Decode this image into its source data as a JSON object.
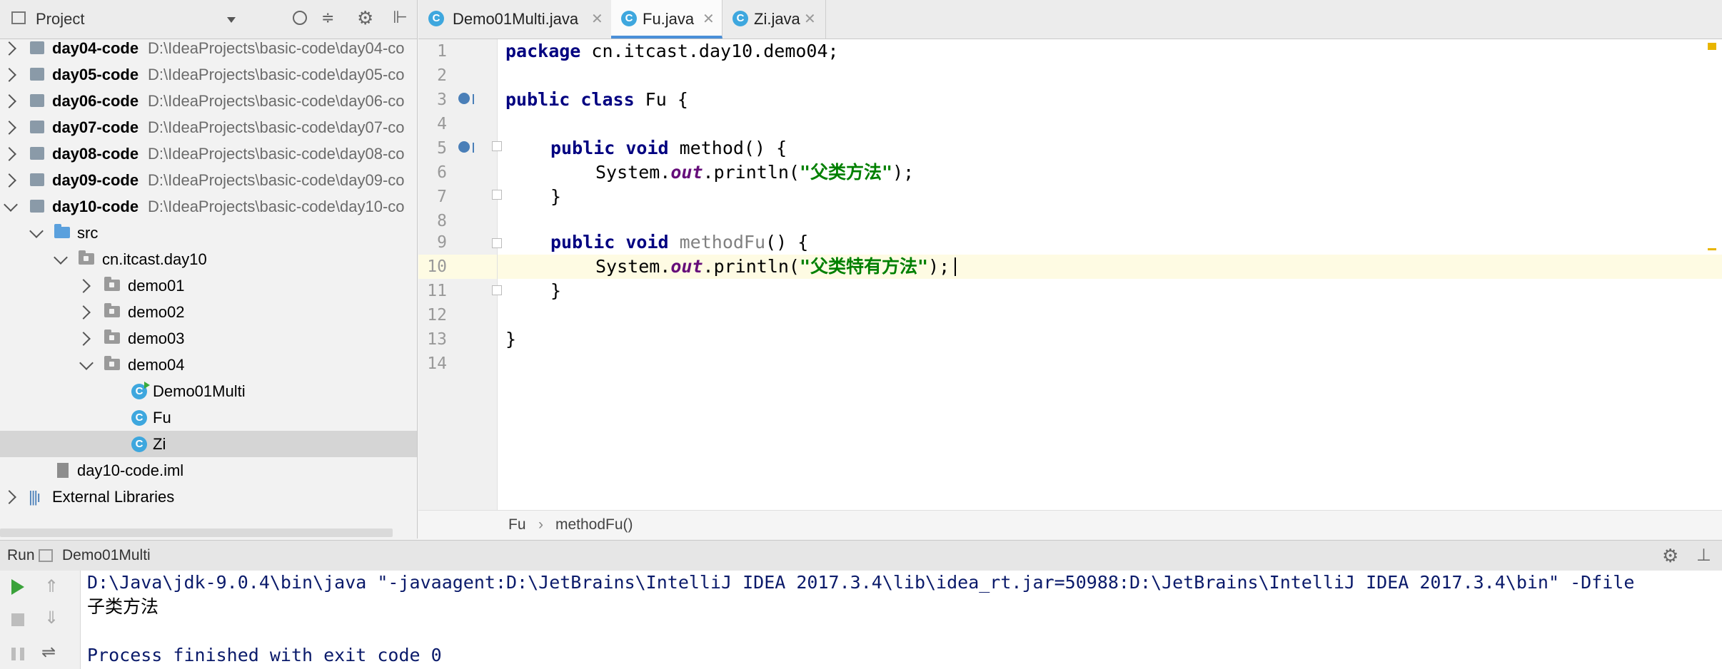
{
  "project": {
    "header_label": "Project",
    "tree": [
      {
        "label": "day04-code",
        "path": "D:\\IdeaProjects\\basic-code\\day04-co"
      },
      {
        "label": "day05-code",
        "path": "D:\\IdeaProjects\\basic-code\\day05-co"
      },
      {
        "label": "day06-code",
        "path": "D:\\IdeaProjects\\basic-code\\day06-co"
      },
      {
        "label": "day07-code",
        "path": "D:\\IdeaProjects\\basic-code\\day07-co"
      },
      {
        "label": "day08-code",
        "path": "D:\\IdeaProjects\\basic-code\\day08-co"
      },
      {
        "label": "day09-code",
        "path": "D:\\IdeaProjects\\basic-code\\day09-co"
      },
      {
        "label": "day10-code",
        "path": "D:\\IdeaProjects\\basic-code\\day10-co"
      }
    ],
    "src": "src",
    "package": "cn.itcast.day10",
    "demos": [
      "demo01",
      "demo02",
      "demo03",
      "demo04"
    ],
    "classes": [
      "Demo01Multi",
      "Fu",
      "Zi"
    ],
    "iml": "day10-code.iml",
    "external": "External Libraries"
  },
  "tabs": [
    {
      "label": "Demo01Multi.java"
    },
    {
      "label": "Fu.java"
    },
    {
      "label": "Zi.java"
    }
  ],
  "editor": {
    "line_numbers": [
      "1",
      "2",
      "3",
      "4",
      "5",
      "6",
      "7",
      "8",
      "9",
      "10",
      "11",
      "12",
      "13",
      "14"
    ],
    "l1_kw": "package",
    "l1_rest": " cn.itcast.day10.demo04;",
    "l3_kw": "public class",
    "l3_rest": " Fu {",
    "l5_kw": "public void",
    "l5_rest": " method() {",
    "l6_a": "System.",
    "l6_field": "out",
    "l6_b": ".println(",
    "l6_str": "\"父类方法\"",
    "l6_c": ");",
    "l7": "}",
    "l9_kw": "public void",
    "l9_name": " methodFu",
    "l9_rest": "() {",
    "l10_a": "System.",
    "l10_field": "out",
    "l10_b": ".println(",
    "l10_str": "\"父类特有方法\"",
    "l10_c": ");",
    "l11": "}",
    "l13": "}"
  },
  "breadcrumb": {
    "class": "Fu",
    "sep": "›",
    "method": "methodFu()"
  },
  "run": {
    "label": "Run",
    "config": "Demo01Multi",
    "console": [
      "D:\\Java\\jdk-9.0.4\\bin\\java \"-javaagent:D:\\JetBrains\\IntelliJ IDEA 2017.3.4\\lib\\idea_rt.jar=50988:D:\\JetBrains\\IntelliJ IDEA 2017.3.4\\bin\" -Dfile",
      "子类方法",
      "",
      "Process finished with exit code 0"
    ]
  },
  "colors": {
    "keyword": "#000080",
    "string": "#008000",
    "field": "#660e7a",
    "current_line": "#fefbe3",
    "class_icon": "#3ea7de"
  }
}
